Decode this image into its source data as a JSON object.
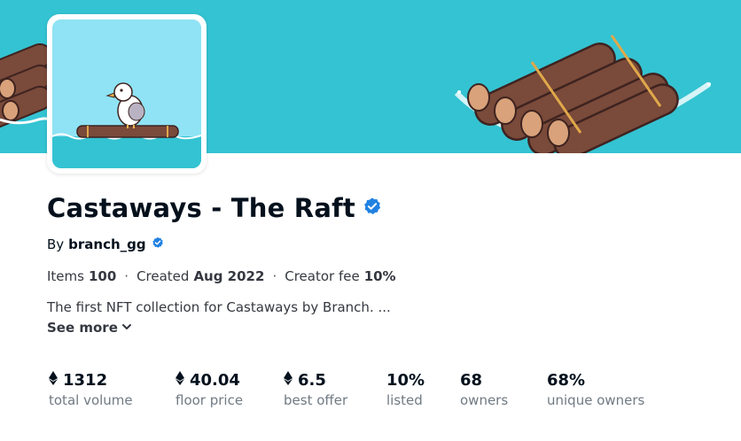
{
  "collection": {
    "title": "Castaways - The Raft",
    "by_prefix": "By",
    "creator": "branch_gg",
    "meta": {
      "items_label": "Items",
      "items_value": "100",
      "created_label": "Created",
      "created_value": "Aug 2022",
      "fee_label": "Creator fee",
      "fee_value": "10%",
      "separator": "·"
    },
    "description": "The first NFT collection for Castaways by Branch. ...",
    "see_more": "See more"
  },
  "stats": [
    {
      "value": "1312",
      "label": "total volume",
      "eth": true
    },
    {
      "value": "40.04",
      "label": "floor price",
      "eth": true
    },
    {
      "value": "6.5",
      "label": "best offer",
      "eth": true
    },
    {
      "value": "10%",
      "label": "listed",
      "eth": false
    },
    {
      "value": "68",
      "label": "owners",
      "eth": false
    },
    {
      "value": "68%",
      "label": "unique owners",
      "eth": false
    }
  ],
  "icons": {
    "verified": "verified-badge-icon",
    "eth": "ethereum-icon",
    "chevron": "chevron-down-icon"
  },
  "colors": {
    "banner": "#34c3d2",
    "avatar_bg": "#8fe3f4",
    "verified": "#2081e2",
    "label_gray": "#707a83",
    "log_brown": "#7a4a3a"
  }
}
